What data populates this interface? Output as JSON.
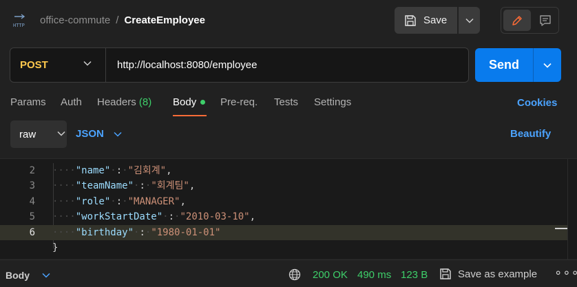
{
  "header": {
    "icon": "http-icon",
    "collection": "office-commute",
    "separator": "/",
    "request_name": "CreateEmployee",
    "save_label": "Save"
  },
  "request": {
    "method": "POST",
    "url": "http://localhost:8080/employee",
    "send_label": "Send"
  },
  "tabs": [
    {
      "label": "Params"
    },
    {
      "label": "Auth"
    },
    {
      "label": "Headers",
      "count": "(8)"
    },
    {
      "label": "Body",
      "active": true
    },
    {
      "label": "Pre-req."
    },
    {
      "label": "Tests"
    },
    {
      "label": "Settings"
    }
  ],
  "cookies_label": "Cookies",
  "body_options": {
    "mode": "raw",
    "language": "JSON",
    "beautify_label": "Beautify"
  },
  "editor": {
    "lines": [
      {
        "num": "2",
        "key": "\"name\"",
        "value": "\"김회계\"",
        "trail": ","
      },
      {
        "num": "3",
        "key": "\"teamName\"",
        "value": "\"회계팀\"",
        "trail": ","
      },
      {
        "num": "4",
        "key": "\"role\"",
        "value": "\"MANAGER\"",
        "trail": ","
      },
      {
        "num": "5",
        "key": "\"workStartDate\"",
        "value": "\"2010-03-10\"",
        "trail": ","
      },
      {
        "num": "6",
        "key": "\"birthday\"",
        "value": "\"1980-01-01\"",
        "trail": ""
      }
    ],
    "closing": "}"
  },
  "status": {
    "panel_label": "Body",
    "code": "200 OK",
    "time": "490 ms",
    "size": "123 B",
    "save_example_label": "Save as example",
    "more": "∘∘∘"
  },
  "colors": {
    "accent_orange": "#ff6c37",
    "send_blue": "#097bed",
    "link_blue": "#4ba3ff",
    "success_green": "#3ecf6a",
    "method_yellow": "#ffc94d"
  }
}
